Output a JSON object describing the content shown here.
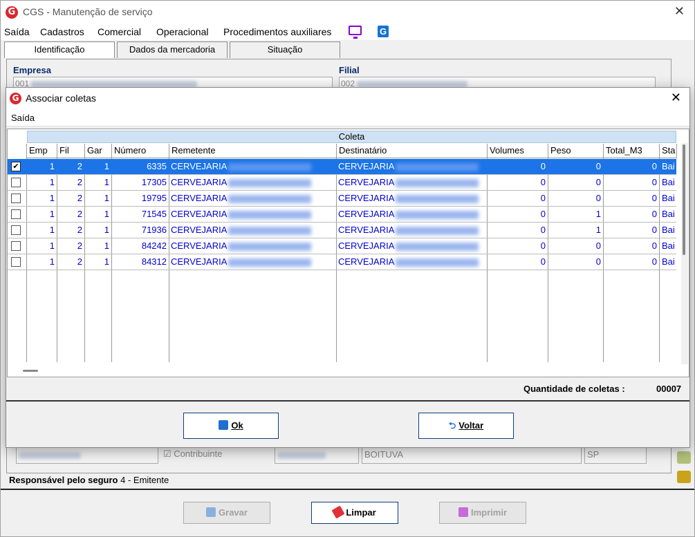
{
  "window": {
    "title": "CGS - Manutenção de serviço",
    "close": "✕"
  },
  "menu": [
    "Saída",
    "Cadastros",
    "Comercial",
    "Operacional",
    "Procedimentos auxiliares"
  ],
  "tabs": [
    "Identificação",
    "Dados da mercadoria",
    "Situação"
  ],
  "background": {
    "empresa_label": "Empresa",
    "empresa_value": "001",
    "filial_label": "Filial",
    "filial_value": "002",
    "contribuinte_label": "Contribuinte",
    "cidade": "BOITUVA",
    "uf": "SP",
    "responsavel_label": "Responsável pelo seguro",
    "responsavel_value": "4 - Emitente"
  },
  "footer_buttons": {
    "gravar": "Gravar",
    "limpar": "Limpar",
    "imprimir": "Imprimir"
  },
  "modal": {
    "title": "Associar coletas",
    "close": "✕",
    "menu": "Saída",
    "group_header": "Coleta",
    "columns": [
      "Emp",
      "Fil",
      "Gar",
      "Número",
      "Remetente",
      "Destinatário",
      "Volumes",
      "Peso",
      "Total_M3",
      "Sta"
    ],
    "rows": [
      {
        "checked": true,
        "emp": "1",
        "fil": "2",
        "gar": "1",
        "numero": "6335",
        "remetente": "CERVEJARIA",
        "destinatario": "CERVEJARIA",
        "volumes": "0",
        "peso": "0",
        "total_m3": "0",
        "status": "Bai"
      },
      {
        "checked": false,
        "emp": "1",
        "fil": "2",
        "gar": "1",
        "numero": "17305",
        "remetente": "CERVEJARIA",
        "destinatario": "CERVEJARIA",
        "volumes": "0",
        "peso": "0",
        "total_m3": "0",
        "status": "Bai"
      },
      {
        "checked": false,
        "emp": "1",
        "fil": "2",
        "gar": "1",
        "numero": "19795",
        "remetente": "CERVEJARIA",
        "destinatario": "CERVEJARIA",
        "volumes": "0",
        "peso": "0",
        "total_m3": "0",
        "status": "Bai"
      },
      {
        "checked": false,
        "emp": "1",
        "fil": "2",
        "gar": "1",
        "numero": "71545",
        "remetente": "CERVEJARIA",
        "destinatario": "CERVEJARIA",
        "volumes": "0",
        "peso": "1",
        "total_m3": "0",
        "status": "Bai"
      },
      {
        "checked": false,
        "emp": "1",
        "fil": "2",
        "gar": "1",
        "numero": "71936",
        "remetente": "CERVEJARIA",
        "destinatario": "CERVEJARIA",
        "volumes": "0",
        "peso": "1",
        "total_m3": "0",
        "status": "Bai"
      },
      {
        "checked": false,
        "emp": "1",
        "fil": "2",
        "gar": "1",
        "numero": "84242",
        "remetente": "CERVEJARIA",
        "destinatario": "CERVEJARIA",
        "volumes": "0",
        "peso": "0",
        "total_m3": "0",
        "status": "Bai"
      },
      {
        "checked": false,
        "emp": "1",
        "fil": "2",
        "gar": "1",
        "numero": "84312",
        "remetente": "CERVEJARIA",
        "destinatario": "CERVEJARIA",
        "volumes": "0",
        "peso": "0",
        "total_m3": "0",
        "status": "Bai"
      }
    ],
    "quantidade_label": "Quantidade de coletas :",
    "quantidade_value": "00007",
    "ok_label": "Ok",
    "voltar_label": "Voltar"
  },
  "colors": {
    "selection": "#1c74e6",
    "cell_text": "#0000d0",
    "brand_red": "#d9272e",
    "header_blue": "#cfe2f3"
  }
}
